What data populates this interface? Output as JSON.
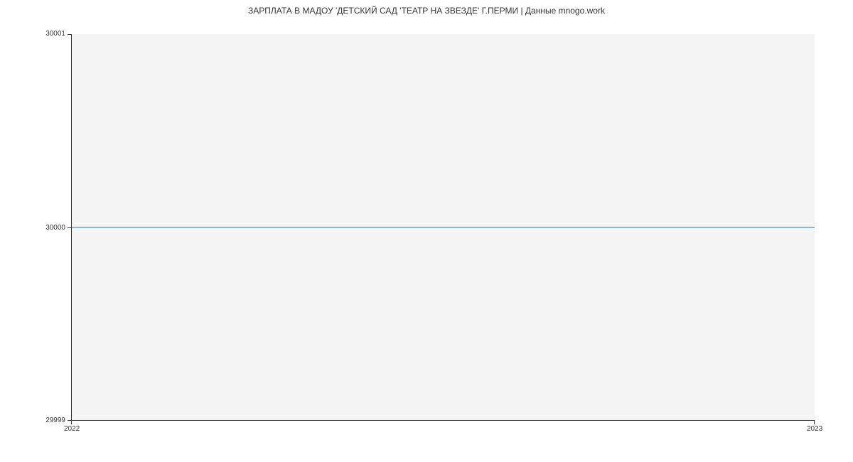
{
  "chart_data": {
    "type": "line",
    "title": "ЗАРПЛАТА В МАДОУ 'ДЕТСКИЙ САД 'ТЕАТР НА ЗВЕЗДЕ' Г.ПЕРМИ | Данные mnogo.work",
    "x": [
      2022,
      2023
    ],
    "values": [
      30000,
      30000
    ],
    "xlabel": "",
    "ylabel": "",
    "y_ticks": [
      "30001",
      "30000",
      "29999"
    ],
    "x_ticks": [
      "2022",
      "2023"
    ],
    "ylim": [
      29999,
      30001
    ],
    "xlim": [
      2022,
      2023
    ],
    "line_color": "#1f77b4"
  }
}
